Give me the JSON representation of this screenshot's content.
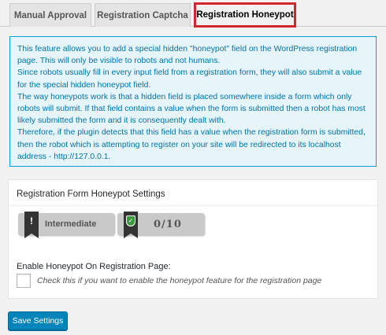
{
  "tabs": [
    {
      "label": "Manual Approval"
    },
    {
      "label": "Registration Captcha"
    },
    {
      "label": "Registration Honeypot"
    }
  ],
  "info": {
    "lines": [
      "This feature allows you to add a special hidden \"honeypot\" field on the WordPress registration page. This will only be visible to robots and not humans.",
      "Since robots usually fill in every input field from a registration form, they will also submit a value for the special hidden honeypot field.",
      "The way honeypots work is that a hidden field is placed somewhere inside a form which only robots will submit. If that field contains a value when the form is submitted then a robot has most likely submitted the form and it is consequently dealt with.",
      "Therefore, if the plugin detects that this field has a value when the registration form is submitted, then the robot which is attempting to register on your site will be redirected to its localhost address - http://127.0.0.1."
    ]
  },
  "settings": {
    "title": "Registration Form Honeypot Settings",
    "level_badge": {
      "icon": "exclamation-flag-icon",
      "label": "Intermediate"
    },
    "score_badge": {
      "icon": "shield-check-icon",
      "value": "0/10"
    },
    "toggle_title": "Enable Honeypot On Registration Page:",
    "toggle_desc": "Check this if you want to enable the honeypot feature for the registration page",
    "checked": false
  },
  "buttons": {
    "save": "Save Settings"
  },
  "colors": {
    "accent": "#0085ba",
    "info_text": "#0073aa",
    "active_tab_border": "#d0262c",
    "shield": "#3c9a3c"
  }
}
